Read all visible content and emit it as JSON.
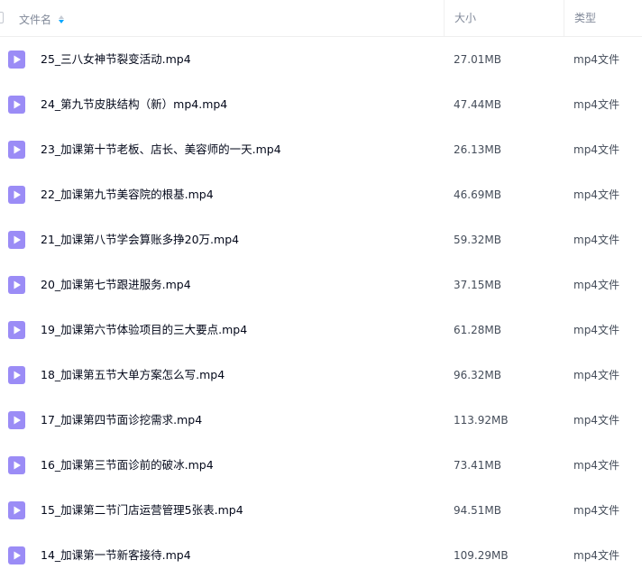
{
  "header": {
    "name_label": "文件名",
    "size_label": "大小",
    "type_label": "类型"
  },
  "colors": {
    "video_icon": "#9b8cf6",
    "sort_active": "#06a7ff"
  },
  "icon_name": "video-file-icon",
  "files": [
    {
      "name": "25_三八女神节裂变活动.mp4",
      "size": "27.01MB",
      "type": "mp4文件"
    },
    {
      "name": "24_第九节皮肤结构（新）mp4.mp4",
      "size": "47.44MB",
      "type": "mp4文件"
    },
    {
      "name": "23_加课第十节老板、店长、美容师的一天.mp4",
      "size": "26.13MB",
      "type": "mp4文件"
    },
    {
      "name": "22_加课第九节美容院的根基.mp4",
      "size": "46.69MB",
      "type": "mp4文件"
    },
    {
      "name": "21_加课第八节学会算账多挣20万.mp4",
      "size": "59.32MB",
      "type": "mp4文件"
    },
    {
      "name": "20_加课第七节跟进服务.mp4",
      "size": "37.15MB",
      "type": "mp4文件"
    },
    {
      "name": "19_加课第六节体验项目的三大要点.mp4",
      "size": "61.28MB",
      "type": "mp4文件"
    },
    {
      "name": "18_加课第五节大单方案怎么写.mp4",
      "size": "96.32MB",
      "type": "mp4文件"
    },
    {
      "name": "17_加课第四节面诊挖需求.mp4",
      "size": "113.92MB",
      "type": "mp4文件"
    },
    {
      "name": "16_加课第三节面诊前的破冰.mp4",
      "size": "73.41MB",
      "type": "mp4文件"
    },
    {
      "name": "15_加课第二节门店运营管理5张表.mp4",
      "size": "94.51MB",
      "type": "mp4文件"
    },
    {
      "name": "14_加课第一节新客接待.mp4",
      "size": "109.29MB",
      "type": "mp4文件"
    }
  ]
}
